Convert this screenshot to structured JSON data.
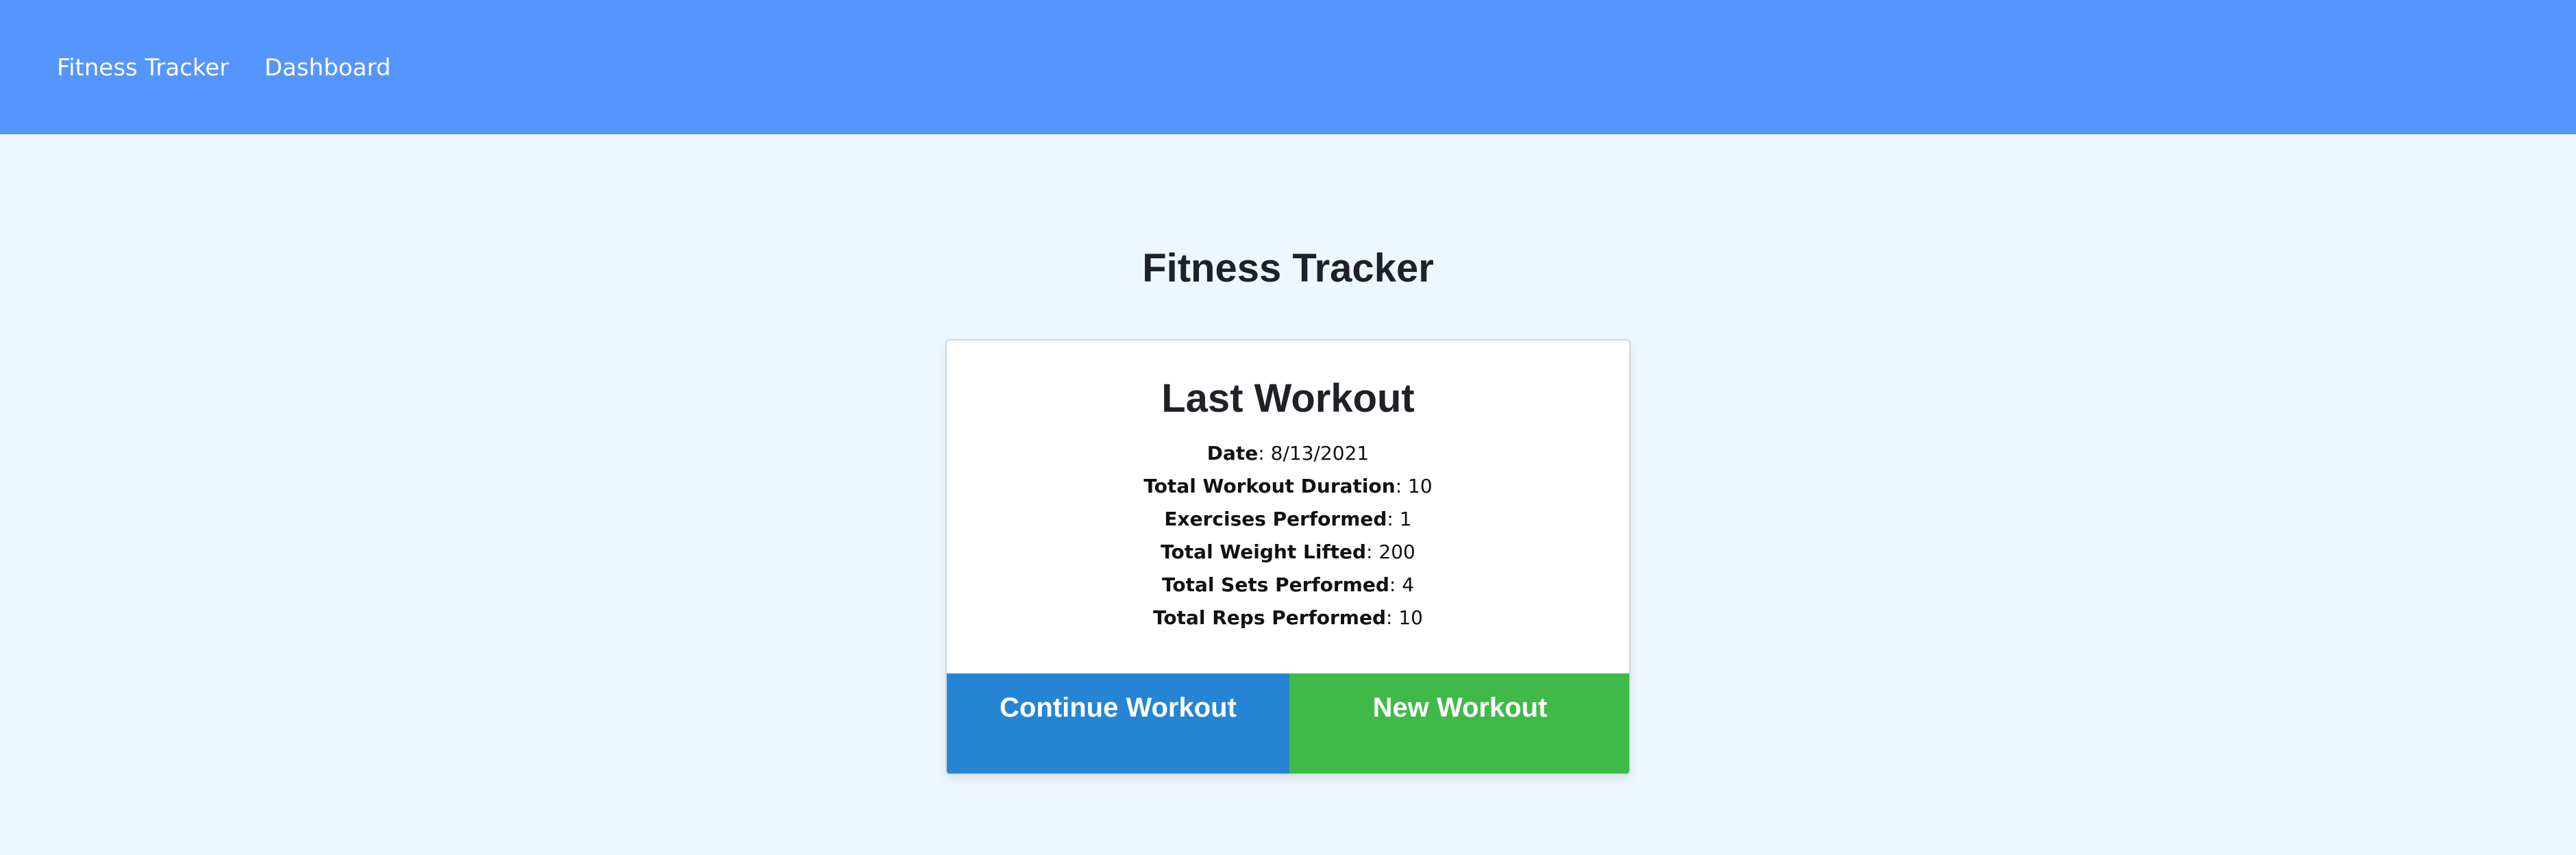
{
  "nav": {
    "brand": "Fitness Tracker",
    "dashboard": "Dashboard"
  },
  "page": {
    "title": "Fitness Tracker"
  },
  "card": {
    "title": "Last Workout",
    "stats": [
      {
        "label": "Date",
        "value": ": 8/13/2021"
      },
      {
        "label": "Total Workout Duration",
        "value": ": 10"
      },
      {
        "label": "Exercises Performed",
        "value": ": 1"
      },
      {
        "label": "Total Weight Lifted",
        "value": ": 200"
      },
      {
        "label": "Total Sets Performed",
        "value": ": 4"
      },
      {
        "label": "Total Reps Performed",
        "value": ": 10"
      }
    ],
    "continue_label": "Continue Workout",
    "new_label": "New Workout"
  },
  "colors": {
    "navbar": "#5595fe",
    "background": "#eef6fe",
    "continue_button": "#2585d3",
    "new_button": "#3fba48"
  }
}
